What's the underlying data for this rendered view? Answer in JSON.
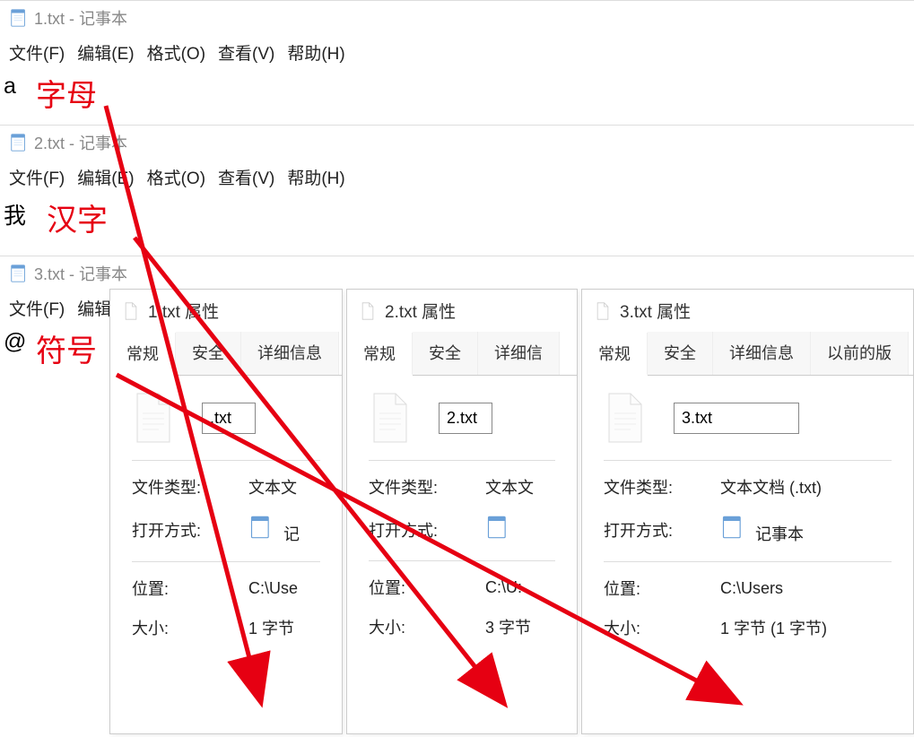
{
  "notepads": [
    {
      "title": "1.txt - 记事本",
      "content": "a",
      "annotation": "字母"
    },
    {
      "title": "2.txt - 记事本",
      "content": "我",
      "annotation": "汉字"
    },
    {
      "title": "3.txt - 记事本",
      "content": "@",
      "annotation": "符号",
      "menu_short": true
    }
  ],
  "menu": {
    "file": "文件(F)",
    "edit": "编辑(E)",
    "format": "格式(O)",
    "view": "查看(V)",
    "help": "帮助(H)",
    "edit_short": "编辑"
  },
  "props_windows": [
    {
      "title": "1.txt 属性",
      "filename": ".txt",
      "tabs": [
        "常规",
        "安全",
        "详细信息"
      ],
      "rows": {
        "type_label": "文件类型:",
        "type_value": "文本文",
        "open_label": "打开方式:",
        "open_value": "记",
        "loc_label": "位置:",
        "loc_value": "C:\\Use",
        "size_label": "大小:",
        "size_value": "1 字节"
      }
    },
    {
      "title": "2.txt 属性",
      "filename": "2.txt",
      "tabs": [
        "常规",
        "安全",
        "详细信"
      ],
      "rows": {
        "type_label": "文件类型:",
        "type_value": "文本文",
        "open_label": "打开方式:",
        "open_value": "",
        "loc_label": "位置:",
        "loc_value": "C:\\U:",
        "size_label": "大小:",
        "size_value": "3 字节"
      }
    },
    {
      "title": "3.txt 属性",
      "filename": "3.txt",
      "tabs": [
        "常规",
        "安全",
        "详细信息",
        "以前的版"
      ],
      "rows": {
        "type_label": "文件类型:",
        "type_value": "文本文档 (.txt)",
        "open_label": "打开方式:",
        "open_value": "记事本",
        "loc_label": "位置:",
        "loc_value": "C:\\Users",
        "size_label": "大小:",
        "size_value": "1 字节 (1 字节)"
      }
    }
  ]
}
